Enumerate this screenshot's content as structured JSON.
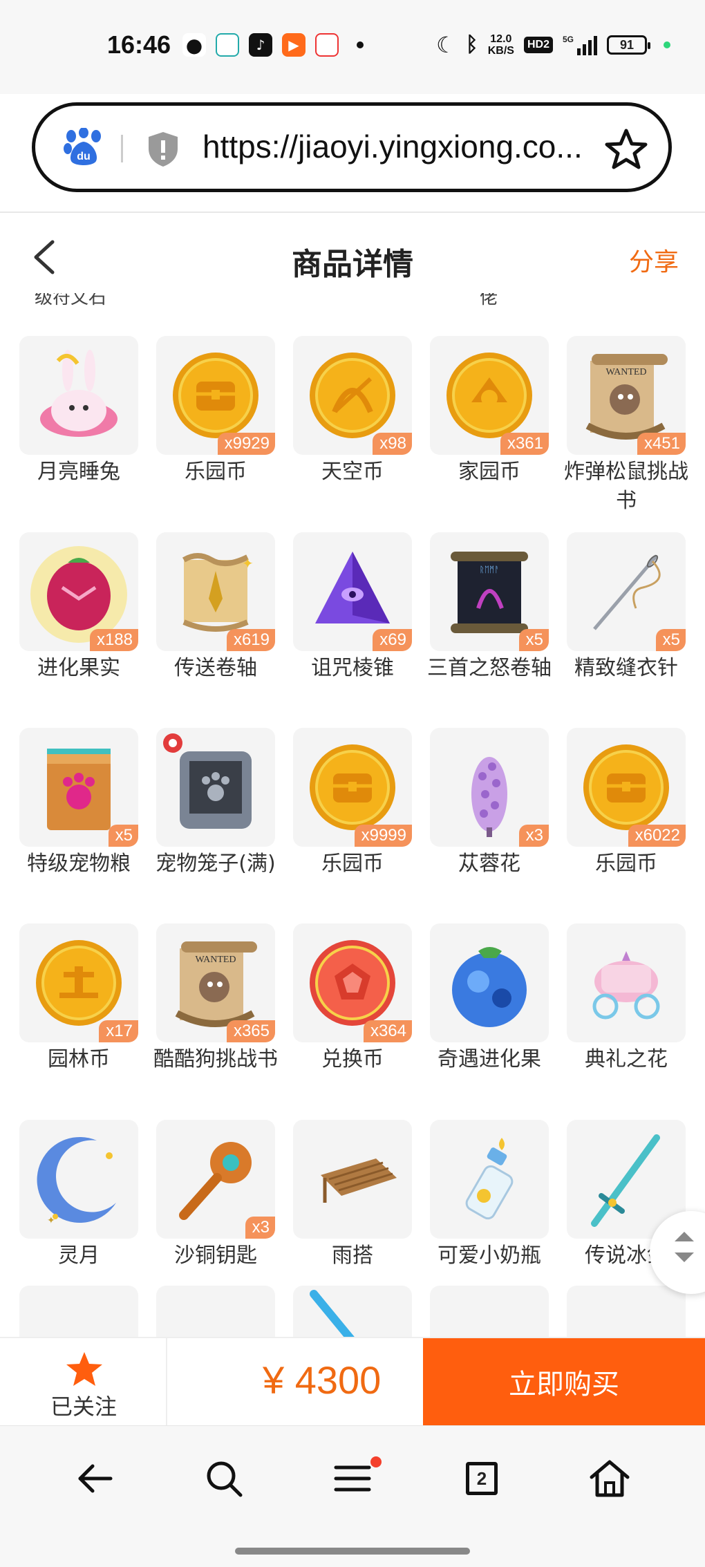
{
  "status_bar": {
    "time": "16:46",
    "net_speed_value": "12.0",
    "net_speed_unit": "KB/S",
    "hd_label": "HD2",
    "network_label": "5G",
    "battery": "91"
  },
  "browser": {
    "url": "https://jiaoyi.yingxiong.co..."
  },
  "header": {
    "title": "商品详情",
    "share_label": "分享"
  },
  "cut_off_text": {
    "left": "级符文石",
    "right": "佬"
  },
  "items": [
    {
      "name": "月亮睡兔",
      "qty": "",
      "icon": "moon-rabbit-icon"
    },
    {
      "name": "乐园币",
      "qty": "x9929",
      "icon": "paradise-coin-icon"
    },
    {
      "name": "天空币",
      "qty": "x98",
      "icon": "sky-coin-icon"
    },
    {
      "name": "家园币",
      "qty": "x361",
      "icon": "home-coin-icon"
    },
    {
      "name": "炸弹松鼠挑战书",
      "qty": "x451",
      "icon": "wanted-scroll-icon"
    },
    {
      "name": "进化果实",
      "qty": "x188",
      "icon": "evolution-fruit-icon"
    },
    {
      "name": "传送卷轴",
      "qty": "x619",
      "icon": "teleport-scroll-icon"
    },
    {
      "name": "诅咒棱锥",
      "qty": "x69",
      "icon": "cursed-pyramid-icon"
    },
    {
      "name": "三首之怒卷轴",
      "qty": "x5",
      "icon": "dark-scroll-icon"
    },
    {
      "name": "精致缝衣针",
      "qty": "x5",
      "icon": "needle-icon"
    },
    {
      "name": "特级宠物粮",
      "qty": "x5",
      "icon": "pet-food-bag-icon"
    },
    {
      "name": "宠物笼子(满)",
      "qty": "",
      "icon": "pet-cage-icon"
    },
    {
      "name": "乐园币",
      "qty": "x9999",
      "icon": "paradise-coin-icon"
    },
    {
      "name": "苁蓉花",
      "qty": "x3",
      "icon": "purple-flower-icon"
    },
    {
      "name": "乐园币",
      "qty": "x6022",
      "icon": "paradise-coin-icon"
    },
    {
      "name": "园林币",
      "qty": "x17",
      "icon": "garden-coin-icon"
    },
    {
      "name": "酷酷狗挑战书",
      "qty": "x365",
      "icon": "wanted-scroll-icon"
    },
    {
      "name": "兑换币",
      "qty": "x364",
      "icon": "exchange-coin-icon"
    },
    {
      "name": "奇遇进化果",
      "qty": "",
      "icon": "blue-fruit-icon"
    },
    {
      "name": "典礼之花",
      "qty": "",
      "icon": "carriage-icon"
    },
    {
      "name": "灵月",
      "qty": "",
      "icon": "crescent-moon-icon"
    },
    {
      "name": "沙铜钥匙",
      "qty": "x3",
      "icon": "bronze-key-icon"
    },
    {
      "name": "雨搭",
      "qty": "",
      "icon": "wooden-awning-icon"
    },
    {
      "name": "可爱小奶瓶",
      "qty": "",
      "icon": "baby-bottle-icon"
    },
    {
      "name": "传说冰剑",
      "qty": "",
      "icon": "ice-sword-icon"
    },
    {
      "name": "",
      "qty": "",
      "icon": "red-item-icon"
    },
    {
      "name": "",
      "qty": "",
      "icon": "white-item-icon"
    },
    {
      "name": "",
      "qty": "",
      "icon": "blue-blade-icon"
    },
    {
      "name": "",
      "qty": "",
      "icon": "monster-eye-icon"
    },
    {
      "name": "",
      "qty": "",
      "icon": "stone-icon"
    }
  ],
  "bottom_bar": {
    "follow_label": "已关注",
    "price": "¥ 4300",
    "buy_label": "立即购买"
  },
  "nav": {
    "tab_count": "2"
  },
  "colors": {
    "accent": "#ff5e0e",
    "price": "#f06a12",
    "qty_badge": "#f5925a"
  }
}
